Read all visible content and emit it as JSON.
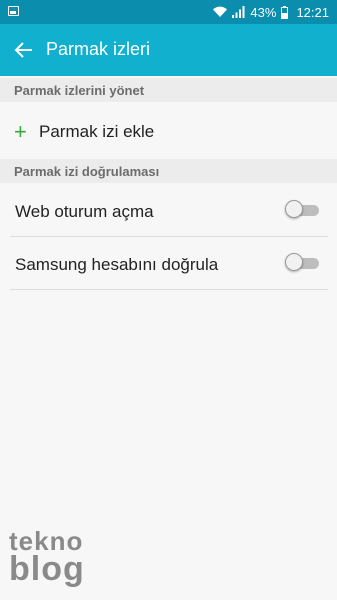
{
  "status_bar": {
    "battery_percent": "43%",
    "time": "12:21",
    "icons": [
      "gallery-icon",
      "wifi-icon",
      "signal-icon",
      "battery-icon"
    ]
  },
  "app_bar": {
    "title": "Parmak izleri",
    "back_icon": "back-arrow-icon"
  },
  "sections": [
    {
      "header": "Parmak izlerini yönet",
      "items": [
        {
          "label": "Parmak izi ekle",
          "icon": "plus-icon",
          "icon_glyph": "+"
        }
      ]
    },
    {
      "header": "Parmak izi doğrulaması",
      "items": [
        {
          "label": "Web oturum açma",
          "toggle_on": false
        },
        {
          "label": "Samsung hesabını doğrula",
          "toggle_on": false
        }
      ]
    }
  ],
  "colors": {
    "status_bar": "#0b8eae",
    "app_bar": "#12b0cf",
    "accent_green": "#3ca63f"
  },
  "watermark": {
    "line1": "tekno",
    "line2": "blog"
  }
}
